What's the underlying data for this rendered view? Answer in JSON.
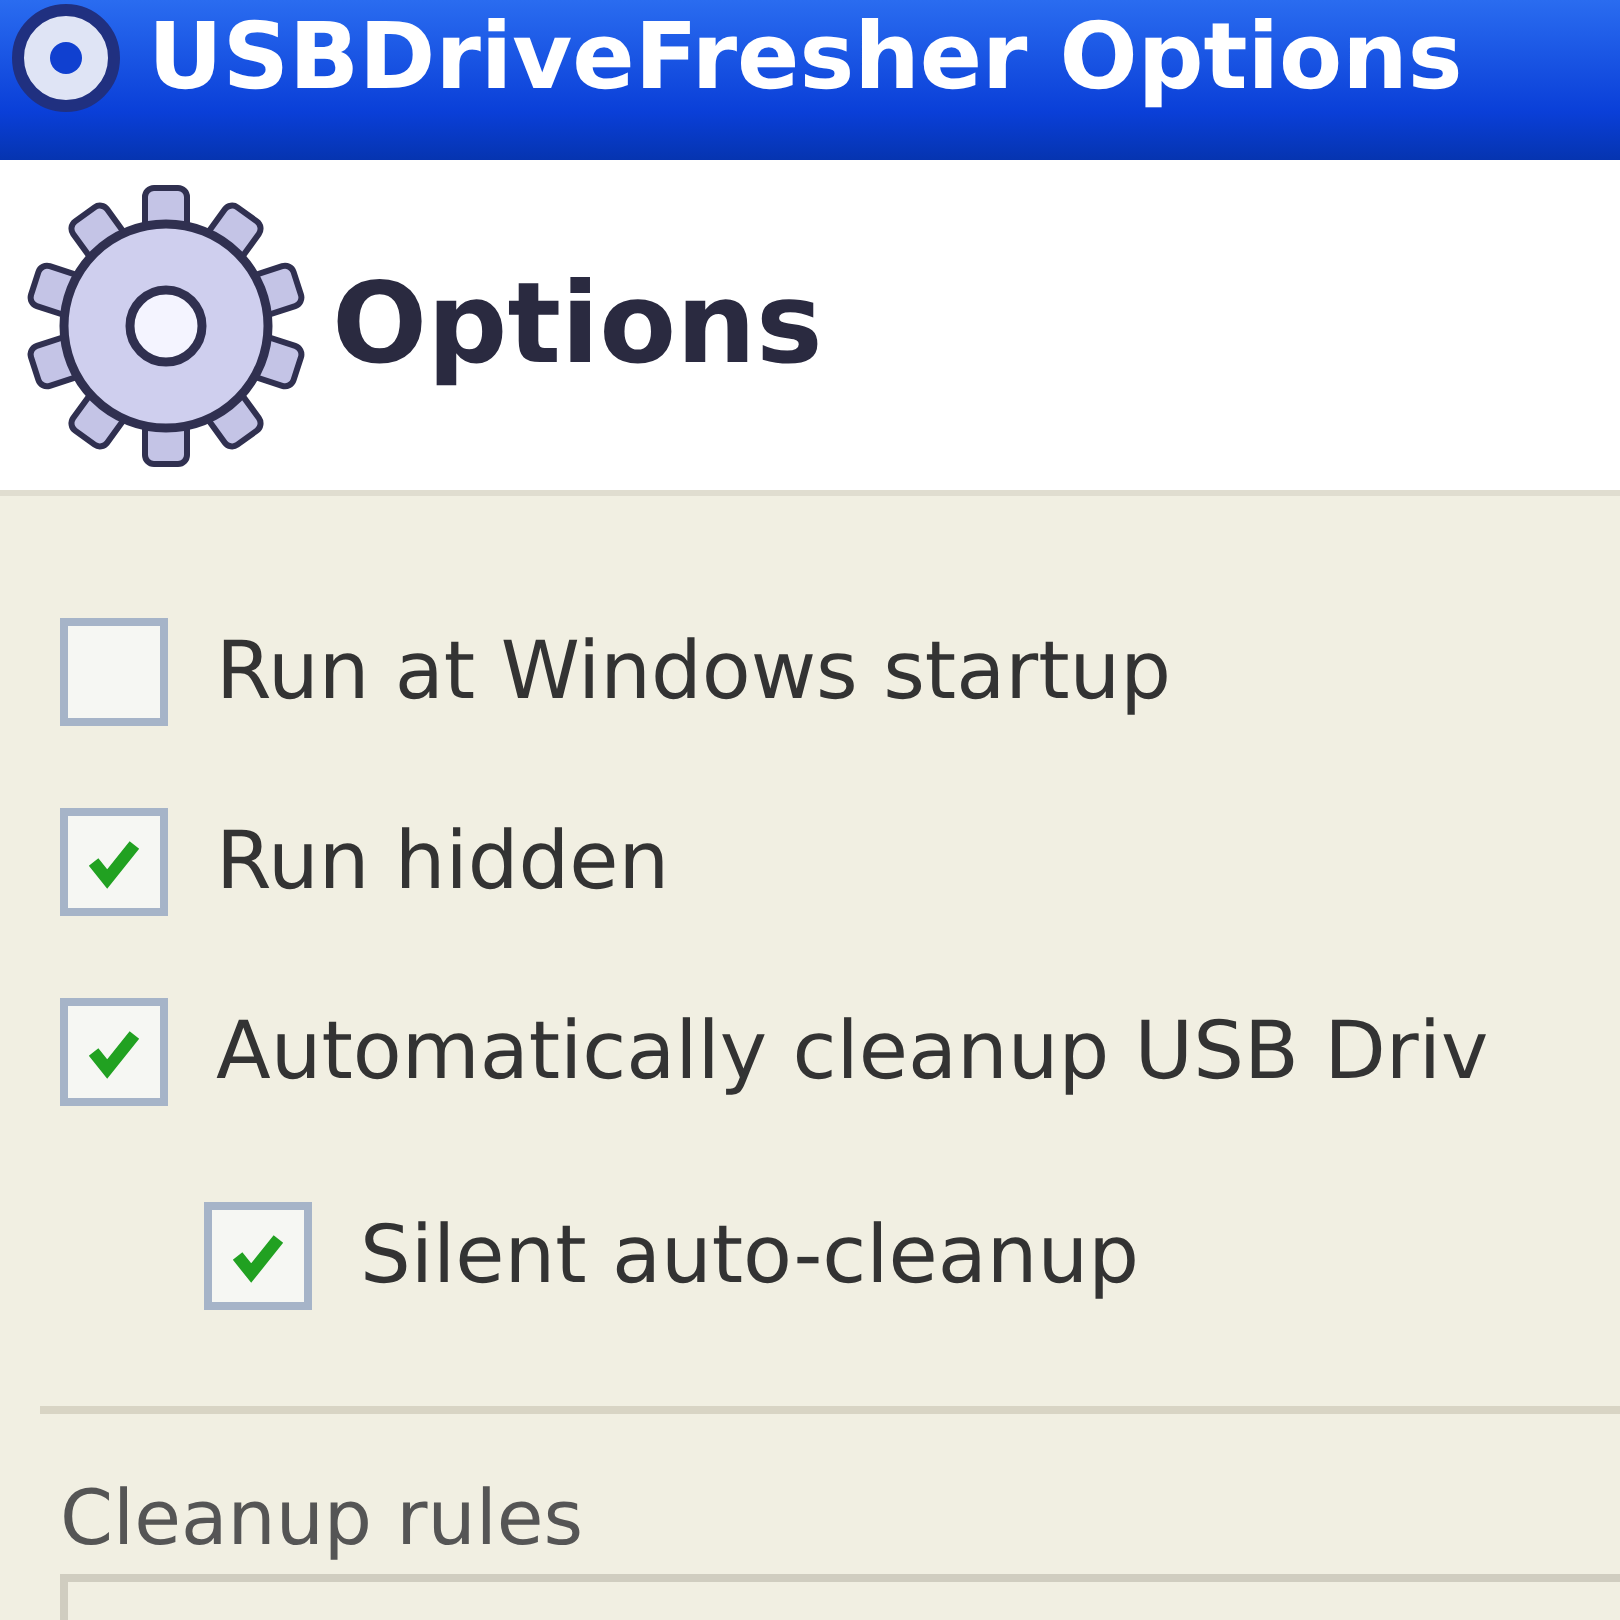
{
  "window": {
    "title": "USBDriveFresher Options"
  },
  "header": {
    "title": "Options"
  },
  "options": [
    {
      "label": "Run at Windows startup",
      "checked": false
    },
    {
      "label": "Run hidden",
      "checked": true
    },
    {
      "label": "Automatically cleanup USB Driv",
      "checked": true,
      "children": [
        {
          "label": "Silent auto-cleanup",
          "checked": true
        }
      ]
    }
  ],
  "cleanup_rules": {
    "label": "Cleanup rules"
  }
}
